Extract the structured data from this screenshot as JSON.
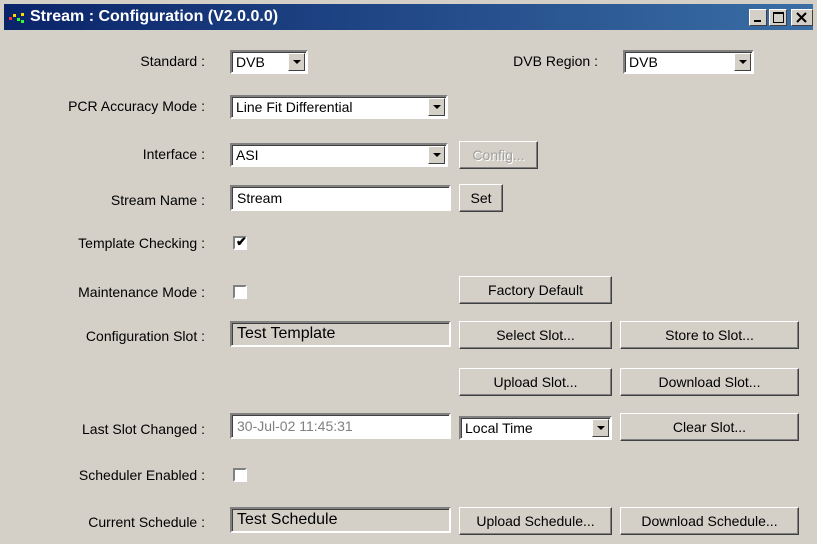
{
  "window": {
    "title": "Stream : Configuration (V2.0.0.0)"
  },
  "standard": {
    "label": "Standard :",
    "value": "DVB"
  },
  "dvb_region": {
    "label": "DVB Region :",
    "value": "DVB"
  },
  "pcr_mode": {
    "label": "PCR Accuracy Mode :",
    "value": "Line Fit Differential"
  },
  "interface": {
    "label": "Interface :",
    "value": "ASI",
    "config_label": "Config..."
  },
  "stream_name": {
    "label": "Stream Name :",
    "value": "Stream",
    "set_label": "Set"
  },
  "template_checking": {
    "label": "Template Checking :",
    "checked": true,
    "mark": "✔"
  },
  "maintenance_mode": {
    "label": "Maintenance Mode :",
    "checked": false,
    "factory_label": "Factory Default"
  },
  "config_slot": {
    "label": "Configuration Slot :",
    "value": "Test Template",
    "select_label": "Select Slot...",
    "store_label": "Store to Slot...",
    "upload_label": "Upload Slot...",
    "download_label": "Download Slot..."
  },
  "last_slot": {
    "label": "Last Slot Changed :",
    "value": "30-Jul-02 11:45:31",
    "time_mode": "Local Time",
    "clear_label": "Clear Slot..."
  },
  "scheduler": {
    "label": "Scheduler Enabled :",
    "checked": false
  },
  "current_schedule": {
    "label": "Current Schedule :",
    "value": "Test Schedule",
    "upload_label": "Upload Schedule...",
    "download_label": "Download Schedule..."
  }
}
